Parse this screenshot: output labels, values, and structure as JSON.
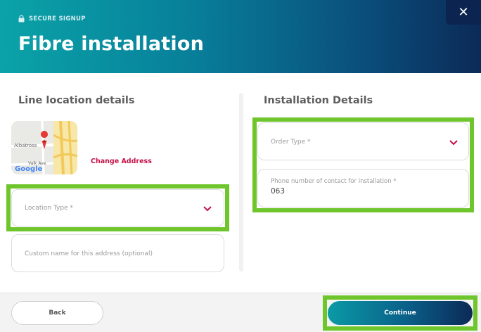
{
  "header": {
    "secure_label": "SECURE SIGNUP",
    "title": "Fibre installation",
    "close_label": "✕"
  },
  "left": {
    "section_title": "Line location details",
    "map": {
      "street1": "Albatross",
      "street2": "Valk Ave",
      "logo": "Google"
    },
    "change_address": "Change Address",
    "location_type": {
      "placeholder": "Location Type *"
    },
    "custom_name": {
      "placeholder": "Custom name for this address (optional)"
    }
  },
  "right": {
    "section_title": "Installation Details",
    "order_type": {
      "placeholder": "Order Type *"
    },
    "phone": {
      "label": "Phone number of contact for installation *",
      "value": "063"
    }
  },
  "footer": {
    "back_label": "Back",
    "continue_label": "Continue"
  },
  "colors": {
    "accent": "#c4124a",
    "highlight": "#6fc62c",
    "header_start": "#0aa3a8",
    "header_end": "#0c2a57"
  }
}
